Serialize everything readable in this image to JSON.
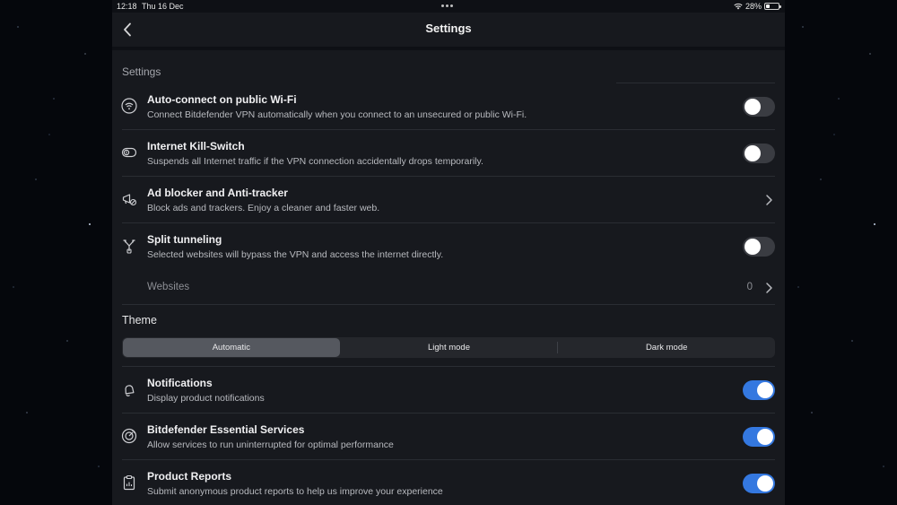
{
  "status_bar": {
    "time": "12:18",
    "date": "Thu 16 Dec",
    "battery": "28%",
    "battery_level": 0.28
  },
  "nav": {
    "title": "Settings"
  },
  "sections": {
    "settings": "Settings",
    "theme": "Theme"
  },
  "rows": {
    "auto_connect": {
      "title": "Auto-connect on public Wi-Fi",
      "desc": "Connect Bitdefender VPN automatically when you connect to an unsecured or public Wi-Fi.",
      "enabled": false
    },
    "kill_switch": {
      "title": "Internet Kill-Switch",
      "desc": "Suspends all Internet traffic if the VPN connection accidentally drops temporarily.",
      "enabled": false
    },
    "ad_blocker": {
      "title": "Ad blocker and Anti-tracker",
      "desc": "Block ads and trackers. Enjoy a cleaner and faster web."
    },
    "split_tunneling": {
      "title": "Split tunneling",
      "desc": "Selected websites will bypass the VPN and access the internet directly.",
      "enabled": false
    },
    "websites": {
      "label": "Websites",
      "count": "0"
    },
    "notifications": {
      "title": "Notifications",
      "desc": "Display product notifications",
      "enabled": true
    },
    "essential_services": {
      "title": "Bitdefender Essential Services",
      "desc": "Allow services to run uninterrupted for optimal performance",
      "enabled": true
    },
    "product_reports": {
      "title": "Product Reports",
      "desc": "Submit anonymous product reports to help us improve your experience",
      "enabled": true
    }
  },
  "theme": {
    "options": [
      "Automatic",
      "Light mode",
      "Dark mode"
    ],
    "selected": "Automatic"
  },
  "colors": {
    "accent": "#3478e0",
    "background": "#17191e",
    "toggle_off": "#3a3c42"
  }
}
